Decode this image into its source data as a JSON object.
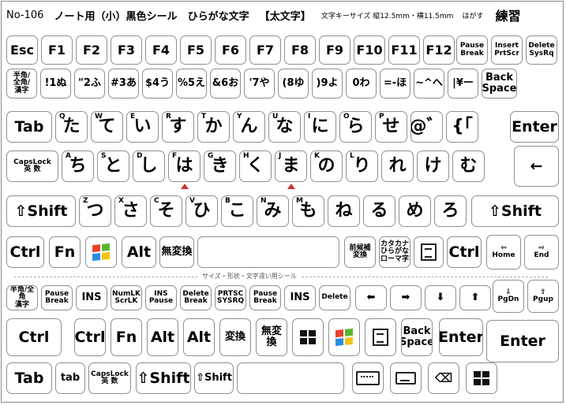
{
  "header": {
    "model": "No-106",
    "title": "ノート用（小）黒色シール",
    "font": "ひらがな文字",
    "bold": "【太文字】",
    "size_info": "文字キーサイズ 縦12.5mm・横11.5mm",
    "peel": "はがす",
    "practice": "練習"
  },
  "separator": {
    "label": "サイズ・形状・文字違い用シール"
  },
  "row1": [
    "Esc",
    "F1",
    "F2",
    "F3",
    "F4",
    "F5",
    "F6",
    "F7",
    "F8",
    "F9",
    "F10",
    "F11",
    "F12",
    "Pause\nBreak",
    "Insert\nPrtScr",
    "Delete\nSysRq"
  ],
  "row2": [
    "半角/\n全角/\n漢字",
    "!1ぬ",
    "\"2ふ",
    "#3あ",
    "$4う",
    "%5え",
    "&6お",
    "'7や",
    "(8ゆ",
    ")9よ",
    "0わ",
    "=-ほ",
    "~^へ",
    "|¥ー",
    "Back\nSpace"
  ],
  "row3": {
    "tab": "Tab",
    "keys": [
      "た",
      "て",
      "い",
      "す",
      "か",
      "ん",
      "な",
      "に",
      "ら",
      "せ",
      "@゛",
      "{「"
    ],
    "letters": [
      "Q",
      "W",
      "E",
      "R",
      "T",
      "Y",
      "U",
      "I",
      "O",
      "P",
      "",
      ""
    ],
    "enter": "Enter"
  },
  "row4": {
    "caps": "CapsLock\n英 数",
    "keys": [
      "ち",
      "と",
      "し",
      "は",
      "き",
      "く",
      "ま",
      "の",
      "り",
      "れ",
      "け",
      "む"
    ],
    "letters": [
      "A",
      "S",
      "D",
      "F",
      "G",
      "H",
      "J",
      "K",
      "L",
      "",
      "",
      ""
    ],
    "enter_arrow": "←"
  },
  "row5": {
    "shift_left": "⇧Shift",
    "keys": [
      "つ",
      "さ",
      "そ",
      "ひ",
      "こ",
      "み",
      "も",
      "ね",
      "る",
      "め",
      "ろ"
    ],
    "letters": [
      "Z",
      "X",
      "C",
      "V",
      "B",
      "N",
      "M",
      "",
      "",
      "",
      ""
    ],
    "shift_right": "⇧Shift"
  },
  "row6": {
    "ctrl": "Ctrl",
    "fn": "Fn",
    "alt": "Alt",
    "muhenkan": "無変換",
    "zenkouho": "前候補\n変換",
    "kana": "カタカナ\nひらがな\nローマ字",
    "ctrl_r": "Ctrl",
    "home": "⇦\nHome",
    "end": "⇨\nEnd"
  },
  "row7": [
    "半角/全角\n漢字",
    "Pause\nBreak",
    "INS",
    "NumLK\nScrLK",
    "INS\nPause",
    "Delete\nBreak",
    "PRTSC\nSYSRQ",
    "Pause\nBreak",
    "INS",
    "Delete",
    "⬅",
    "➡",
    "⬇",
    "⬆",
    "⇩\nPgDn",
    "⇧\nPgup"
  ],
  "row8": [
    "Ctrl",
    "Ctrl",
    "Fn",
    "Alt",
    "Alt",
    "変換",
    "無変換",
    "",
    "",
    "",
    "Back\nSpace",
    "Enter",
    "Enter"
  ],
  "row9": [
    "Tab",
    "tab",
    "CapsLock\n英 数",
    "⇧Shift",
    "⇧Shift"
  ],
  "colors": {
    "win_red": "#e8442c",
    "win_green": "#5cb531",
    "win_blue": "#2a8ee0",
    "win_yellow": "#f4c312",
    "marker": "#d32f2f"
  }
}
